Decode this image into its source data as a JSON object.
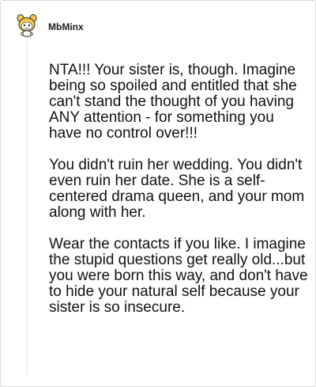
{
  "comment": {
    "username": "MbMinx",
    "avatar_icon": "snoo-avatar-icon",
    "paragraphs": [
      "NTA!!! Your sister is, though. Imagine being so spoiled and entitled that she can't stand the thought of you having ANY attention - for something you have no control over!!!",
      "You didn't ruin her wedding. You didn't even ruin her date. She is a self-centered drama queen, and your mom along with her.",
      "Wear the contacts if you like. I imagine the stupid questions get really old...but you were born this way, and don't have to hide your natural self because your sister is so insecure."
    ]
  },
  "colors": {
    "avatar_fill": "#f2c94c",
    "avatar_outline": "#2b2b2b",
    "thread_line": "#e2e2e2",
    "text": "#111111"
  }
}
